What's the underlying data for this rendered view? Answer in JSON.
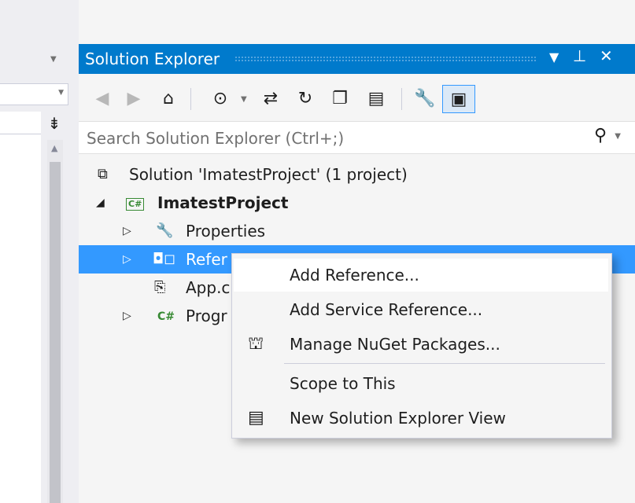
{
  "solution_explorer": {
    "title": "Solution Explorer",
    "title_buttons": [
      "▾",
      "⊥",
      "✕"
    ],
    "search_placeholder": "Search Solution Explorer (Ctrl+;)",
    "tree": {
      "solution": "Solution 'ImatestProject' (1 project)",
      "project": "ImatestProject",
      "project_badge": "C#",
      "properties": "Properties",
      "references": "Refer",
      "app_config": "App.c",
      "program": "Progr",
      "program_badge": "C#"
    }
  },
  "context_menu": {
    "items": [
      "Add Reference...",
      "Add Service Reference...",
      "Manage NuGet Packages...",
      "Scope to This",
      "New Solution Explorer View"
    ]
  },
  "colors": {
    "accent": "#007acc",
    "selection": "#3399ff",
    "csharp_green": "#388a34"
  },
  "icons": {
    "back": "back-icon",
    "forward": "forward-icon",
    "home": "home-icon",
    "pending_changes": "pending-changes-icon",
    "sync": "sync-icon",
    "refresh": "refresh-icon",
    "collapse_all": "collapse-all-icon",
    "show_all_files": "show-all-files-icon",
    "properties": "wrench-icon",
    "preview": "preview-icon",
    "search": "search-icon",
    "nuget": "nuget-icon",
    "new_view": "new-view-icon"
  }
}
